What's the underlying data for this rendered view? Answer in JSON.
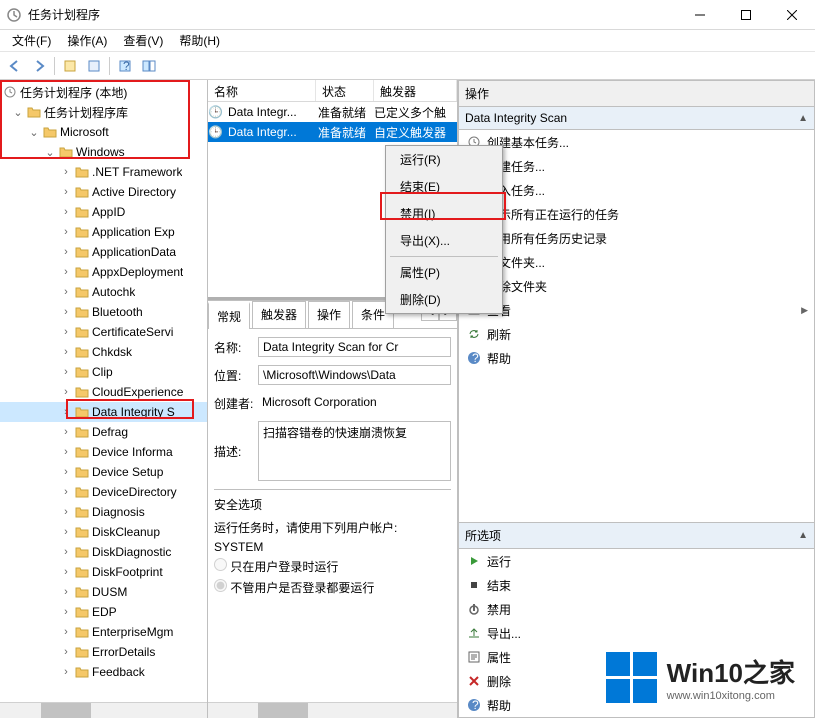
{
  "titlebar": {
    "title": "任务计划程序"
  },
  "menubar": {
    "file": "文件(F)",
    "action": "操作(A)",
    "view": "查看(V)",
    "help": "帮助(H)"
  },
  "tree": {
    "root": "任务计划程序 (本地)",
    "lib": "任务计划程序库",
    "microsoft": "Microsoft",
    "windows": "Windows",
    "folders": [
      ".NET Framework",
      "Active Directory",
      "AppID",
      "Application Exp",
      "ApplicationData",
      "AppxDeployment",
      "Autochk",
      "Bluetooth",
      "CertificateServi",
      "Chkdsk",
      "Clip",
      "CloudExperience",
      "Data Integrity S",
      "Defrag",
      "Device Informa",
      "Device Setup",
      "DeviceDirectory",
      "Diagnosis",
      "DiskCleanup",
      "DiskDiagnostic",
      "DiskFootprint",
      "DUSM",
      "EDP",
      "EnterpriseMgm",
      "ErrorDetails",
      "Feedback"
    ]
  },
  "taskList": {
    "cols": {
      "name": "名称",
      "status": "状态",
      "trigger": "触发器"
    },
    "rows": [
      {
        "name": "Data Integr...",
        "status": "准备就绪",
        "trigger": "已定义多个触"
      },
      {
        "name": "Data Integr...",
        "status": "准备就绪",
        "trigger": "自定义触发器"
      }
    ]
  },
  "ctx": {
    "run": "运行(R)",
    "end": "结束(E)",
    "disable": "禁用(I)",
    "export": "导出(X)...",
    "prop": "属性(P)",
    "delete": "删除(D)"
  },
  "tabs": {
    "general": "常规",
    "triggers": "触发器",
    "actions": "操作",
    "conditions": "条件"
  },
  "detail": {
    "nameLabel": "名称:",
    "name": "Data Integrity Scan for Cr",
    "locLabel": "位置:",
    "loc": "\\Microsoft\\Windows\\Data",
    "authorLabel": "创建者:",
    "author": "Microsoft Corporation",
    "descLabel": "描述:",
    "desc": "扫描容错卷的快速崩溃恢复",
    "secTitle": "安全选项",
    "secLine": "运行任务时，请使用下列用户帐户:",
    "secAcct": "SYSTEM",
    "secOpt1": "只在用户登录时运行",
    "secOpt2": "不管用户是否登录都要运行"
  },
  "actionsPane": {
    "header": "操作",
    "title": "Data Integrity Scan",
    "items1": [
      {
        "icon": "task",
        "label": "创建基本任务..."
      },
      {
        "icon": "task",
        "label": "创建任务..."
      },
      {
        "icon": "import",
        "label": "导入任务..."
      },
      {
        "icon": "show",
        "label": "显示所有正在运行的任务"
      },
      {
        "icon": "enable",
        "label": "启用所有任务历史记录"
      },
      {
        "icon": "newf",
        "label": "新文件夹..."
      },
      {
        "icon": "delf",
        "label": "删除文件夹"
      },
      {
        "icon": "view",
        "label": "查看",
        "arrow": true
      },
      {
        "icon": "refresh",
        "label": "刷新"
      },
      {
        "icon": "help",
        "label": "帮助"
      }
    ],
    "title2": "所选项",
    "items2": [
      {
        "icon": "run",
        "label": "运行"
      },
      {
        "icon": "end",
        "label": "结束"
      },
      {
        "icon": "disable",
        "label": "禁用"
      },
      {
        "icon": "export",
        "label": "导出..."
      },
      {
        "icon": "prop",
        "label": "属性"
      },
      {
        "icon": "delete",
        "label": "删除"
      },
      {
        "icon": "help",
        "label": "帮助"
      }
    ]
  },
  "watermark": {
    "big": "Win10之家",
    "small": "www.win10xitong.com"
  }
}
